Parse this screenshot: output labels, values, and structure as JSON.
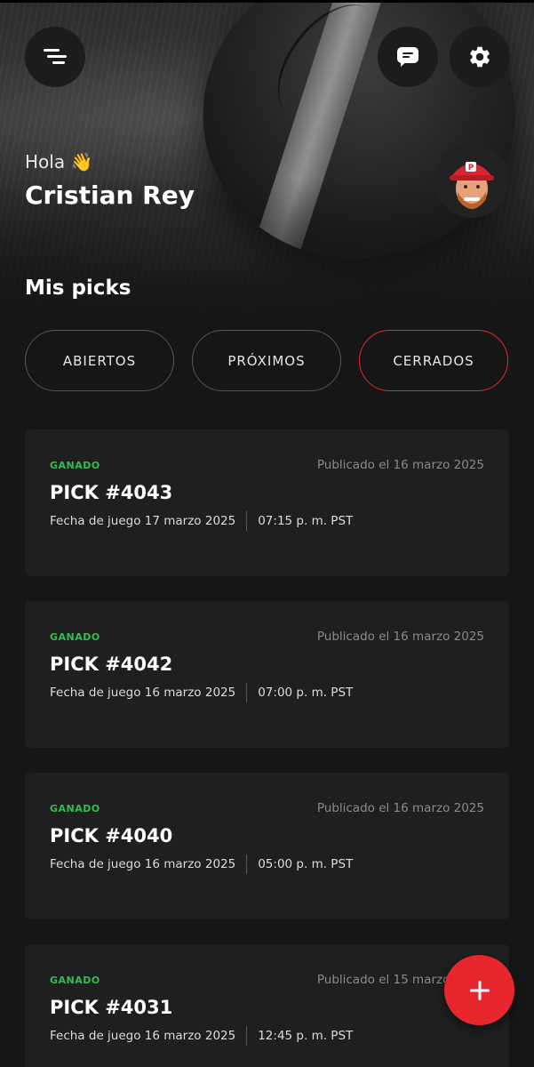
{
  "header": {
    "greeting": "Hola 👋",
    "user_name": "Cristian Rey",
    "menu_icon": "menu-icon",
    "chat_icon": "chat-icon",
    "settings_icon": "gear-icon"
  },
  "section": {
    "title": "Mis picks"
  },
  "tabs": [
    {
      "label": "ABIERTOS",
      "active": false
    },
    {
      "label": "PRÓXIMOS",
      "active": false
    },
    {
      "label": "CERRADOS",
      "active": true
    }
  ],
  "picks": [
    {
      "status": "GANADO",
      "published": "Publicado el 16 marzo 2025",
      "title": "PICK #4043",
      "game_date": "Fecha de juego 17 marzo 2025",
      "game_time": "07:15 p. m. PST"
    },
    {
      "status": "GANADO",
      "published": "Publicado el 16 marzo 2025",
      "title": "PICK #4042",
      "game_date": "Fecha de juego 16 marzo 2025",
      "game_time": "07:00 p. m. PST"
    },
    {
      "status": "GANADO",
      "published": "Publicado el 16 marzo 2025",
      "title": "PICK #4040",
      "game_date": "Fecha de juego 16 marzo 2025",
      "game_time": "05:00 p. m. PST"
    },
    {
      "status": "GANADO",
      "published": "Publicado el 15 marzo 2025",
      "title": "PICK #4031",
      "game_date": "Fecha de juego 16 marzo 2025",
      "game_time": "12:45 p. m. PST"
    }
  ],
  "fab": {
    "icon": "plus-icon"
  },
  "colors": {
    "accent": "#e8262e",
    "won": "#2fbf52",
    "card": "#1f1f1f",
    "background": "#161616"
  }
}
